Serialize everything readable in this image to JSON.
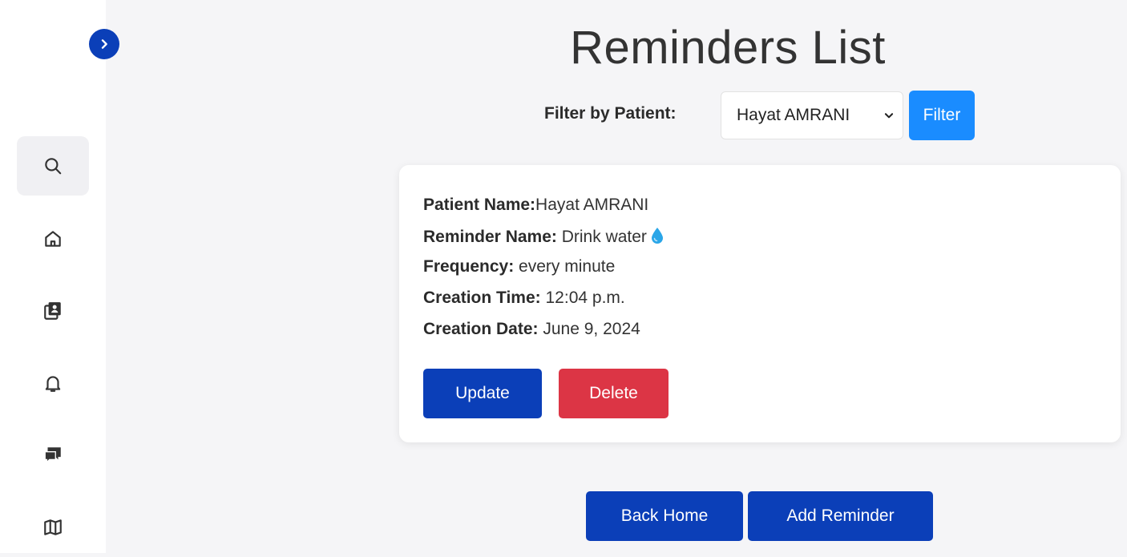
{
  "page": {
    "title": "Reminders List"
  },
  "sidebar": {
    "toggle_icon": "chevron-right-icon",
    "items": [
      {
        "icon": "search-icon",
        "active": true
      },
      {
        "icon": "home-icon",
        "active": false
      },
      {
        "icon": "contacts-book-icon",
        "active": false
      },
      {
        "icon": "bell-icon",
        "active": false
      },
      {
        "icon": "chat-icon",
        "active": false
      },
      {
        "icon": "map-icon",
        "active": false
      }
    ]
  },
  "filter": {
    "label": "Filter by Patient:",
    "selected_patient": "Hayat AMRANI",
    "button_label": "Filter"
  },
  "reminder": {
    "patient_label": "Patient Name:",
    "patient_value": "Hayat AMRANI",
    "name_label": "Reminder Name:",
    "name_value": "Drink water",
    "name_icon": "water-drop-icon",
    "frequency_label": "Frequency:",
    "frequency_value": "every minute",
    "time_label": "Creation Time:",
    "time_value": "12:04 p.m.",
    "date_label": "Creation Date:",
    "date_value": "June 9, 2024",
    "update_label": "Update",
    "delete_label": "Delete"
  },
  "footer": {
    "back_label": "Back Home",
    "add_label": "Add Reminder"
  },
  "colors": {
    "primary": "#0b3fb8",
    "filter_button": "#1a8cff",
    "danger": "#dc3545",
    "background": "#f5f5f7"
  }
}
